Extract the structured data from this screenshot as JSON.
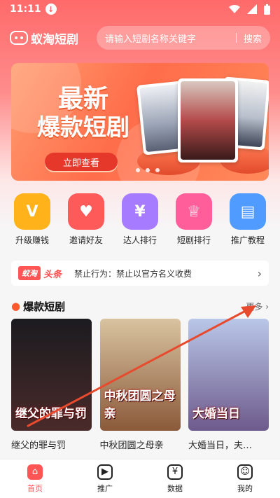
{
  "status": {
    "time": "11:11"
  },
  "header": {
    "logo": "蚁淘短剧",
    "search_placeholder": "请输入短剧名称关键字",
    "search_button": "搜索"
  },
  "banner": {
    "line1": "最新",
    "line2": "爆款短剧",
    "cta": "立即查看"
  },
  "quick": [
    {
      "label": "升级赚钱",
      "icon": "v-icon",
      "color": "#ffb21a",
      "glyph": "V"
    },
    {
      "label": "邀请好友",
      "icon": "user-add-icon",
      "color": "#ff5a5a",
      "glyph": "♥"
    },
    {
      "label": "达人排行",
      "icon": "money-bag-icon",
      "color": "#a67bff",
      "glyph": "¥"
    },
    {
      "label": "短剧排行",
      "icon": "trophy-icon",
      "color": "#ff5e9b",
      "glyph": "♕"
    },
    {
      "label": "推广教程",
      "icon": "book-icon",
      "color": "#4f9bff",
      "glyph": "▤"
    }
  ],
  "notice": {
    "brand": "蚁淘",
    "tag": "头条",
    "text": "禁止行为：禁止以官方名义收费"
  },
  "section": {
    "title": "爆款短剧",
    "more": "更多"
  },
  "dramas": [
    {
      "title": "继父的罪与罚",
      "caption": "继父的罪与罚",
      "color_top": "#1b1b1f",
      "color_bottom": "#4a2a2a"
    },
    {
      "title": "中秋团圆之母亲",
      "caption": "中秋团圆之母亲",
      "color_top": "#d9c3a0",
      "color_bottom": "#8a5a3a"
    },
    {
      "title": "大婚当日，夫…",
      "caption": "大婚当日",
      "color_top": "#b9c7e8",
      "color_bottom": "#6d5a8c"
    }
  ],
  "tabs": [
    {
      "label": "首页",
      "icon": "home-icon",
      "active": true
    },
    {
      "label": "推广",
      "icon": "tv-icon",
      "active": false
    },
    {
      "label": "数据",
      "icon": "coin-bag-icon",
      "active": false
    },
    {
      "label": "我的",
      "icon": "smile-icon",
      "active": false
    }
  ],
  "colors": {
    "accent": "#ff5555",
    "annotation": "#e84a2e"
  }
}
